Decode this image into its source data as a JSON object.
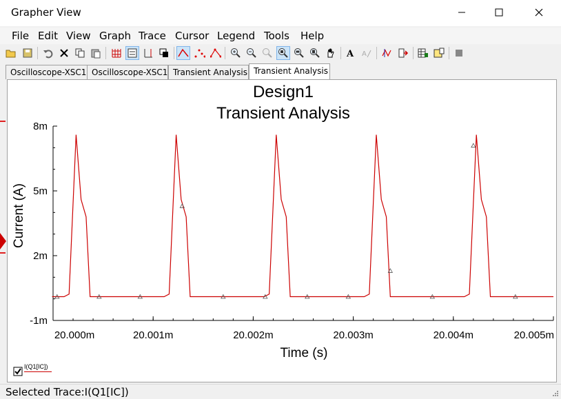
{
  "window": {
    "title": "Grapher View"
  },
  "menu": [
    "File",
    "Edit",
    "View",
    "Graph",
    "Trace",
    "Cursor",
    "Legend",
    "Tools",
    "Help"
  ],
  "toolbar": {
    "icons": [
      "open-icon",
      "save-icon",
      "undo-icon",
      "delete-icon",
      "copy-icon",
      "paste-icon",
      "grid-icon",
      "legend-icon",
      "dual-axis-icon",
      "overlay-icon",
      "trace-line-icon",
      "trace-points-icon",
      "trace-line-points-icon",
      "zoom-in-icon",
      "zoom-out-icon",
      "zoom-full-icon",
      "zoom-x-icon",
      "zoom-y-icon",
      "zoom-area-icon",
      "pan-icon",
      "text-icon",
      "font-color-icon",
      "cursors-icon",
      "export-icon",
      "export-data-icon",
      "print-icon",
      "stop-icon"
    ]
  },
  "tabs": [
    "Oscilloscope-XSC1",
    "Oscilloscope-XSC1",
    "Transient Analysis",
    "Transient Analysis"
  ],
  "chart_data": {
    "type": "line",
    "title": "Design1",
    "subtitle": "Transient Analysis",
    "xlabel": "Time (s)",
    "ylabel": "Current (A)",
    "x_ticks": [
      "20.000m",
      "20.001m",
      "20.002m",
      "20.003m",
      "20.004m",
      "20.005m"
    ],
    "y_ticks": [
      "8m",
      "5m",
      "2m",
      "-1m"
    ],
    "xlim": [
      20.0,
      20.005
    ],
    "ylim": [
      -0.001,
      0.008
    ],
    "grid": false,
    "series": [
      {
        "name": "I(Q1[IC])",
        "color": "#cc0000",
        "x": [
          19.99996,
          20.00011,
          20.00016,
          20.00023,
          20.00028,
          20.00033,
          20.00037,
          20.00049,
          20.00111,
          20.00116,
          20.00123,
          20.00128,
          20.00133,
          20.00137,
          20.00149,
          20.00211,
          20.00216,
          20.00223,
          20.00228,
          20.00233,
          20.00237,
          20.00249,
          20.00311,
          20.00316,
          20.00323,
          20.00328,
          20.00333,
          20.00337,
          20.00349,
          20.00411,
          20.00416,
          20.00423,
          20.00428,
          20.00433,
          20.00437,
          20.00449,
          20.005
        ],
        "y": [
          0.0001,
          0.0001,
          0.00022,
          0.0076,
          0.0046,
          0.0038,
          0.0001,
          0.0001,
          0.0001,
          0.00022,
          0.0076,
          0.0046,
          0.0038,
          0.0001,
          0.0001,
          0.0001,
          0.00022,
          0.0076,
          0.0046,
          0.0038,
          0.0001,
          0.0001,
          0.0001,
          0.00022,
          0.0076,
          0.0046,
          0.0038,
          0.0001,
          0.0001,
          0.0001,
          0.00022,
          0.0076,
          0.0046,
          0.0038,
          0.0001,
          0.0001,
          0.0001
        ],
        "markers_x": [
          20.00004,
          20.00046,
          20.00087,
          20.00129,
          20.0017,
          20.00212,
          20.00254,
          20.00295,
          20.00337,
          20.00379,
          20.0042,
          20.00462
        ],
        "markers_y": [
          0.0001,
          0.0001,
          0.0001,
          0.0043,
          0.0001,
          0.0001,
          0.0001,
          0.0001,
          0.0013,
          0.0001,
          0.0071,
          0.0001
        ]
      }
    ]
  },
  "legend": {
    "label": "I(Q1[IC])",
    "checked": true
  },
  "status": {
    "text": "Selected Trace:I(Q1[IC])"
  }
}
